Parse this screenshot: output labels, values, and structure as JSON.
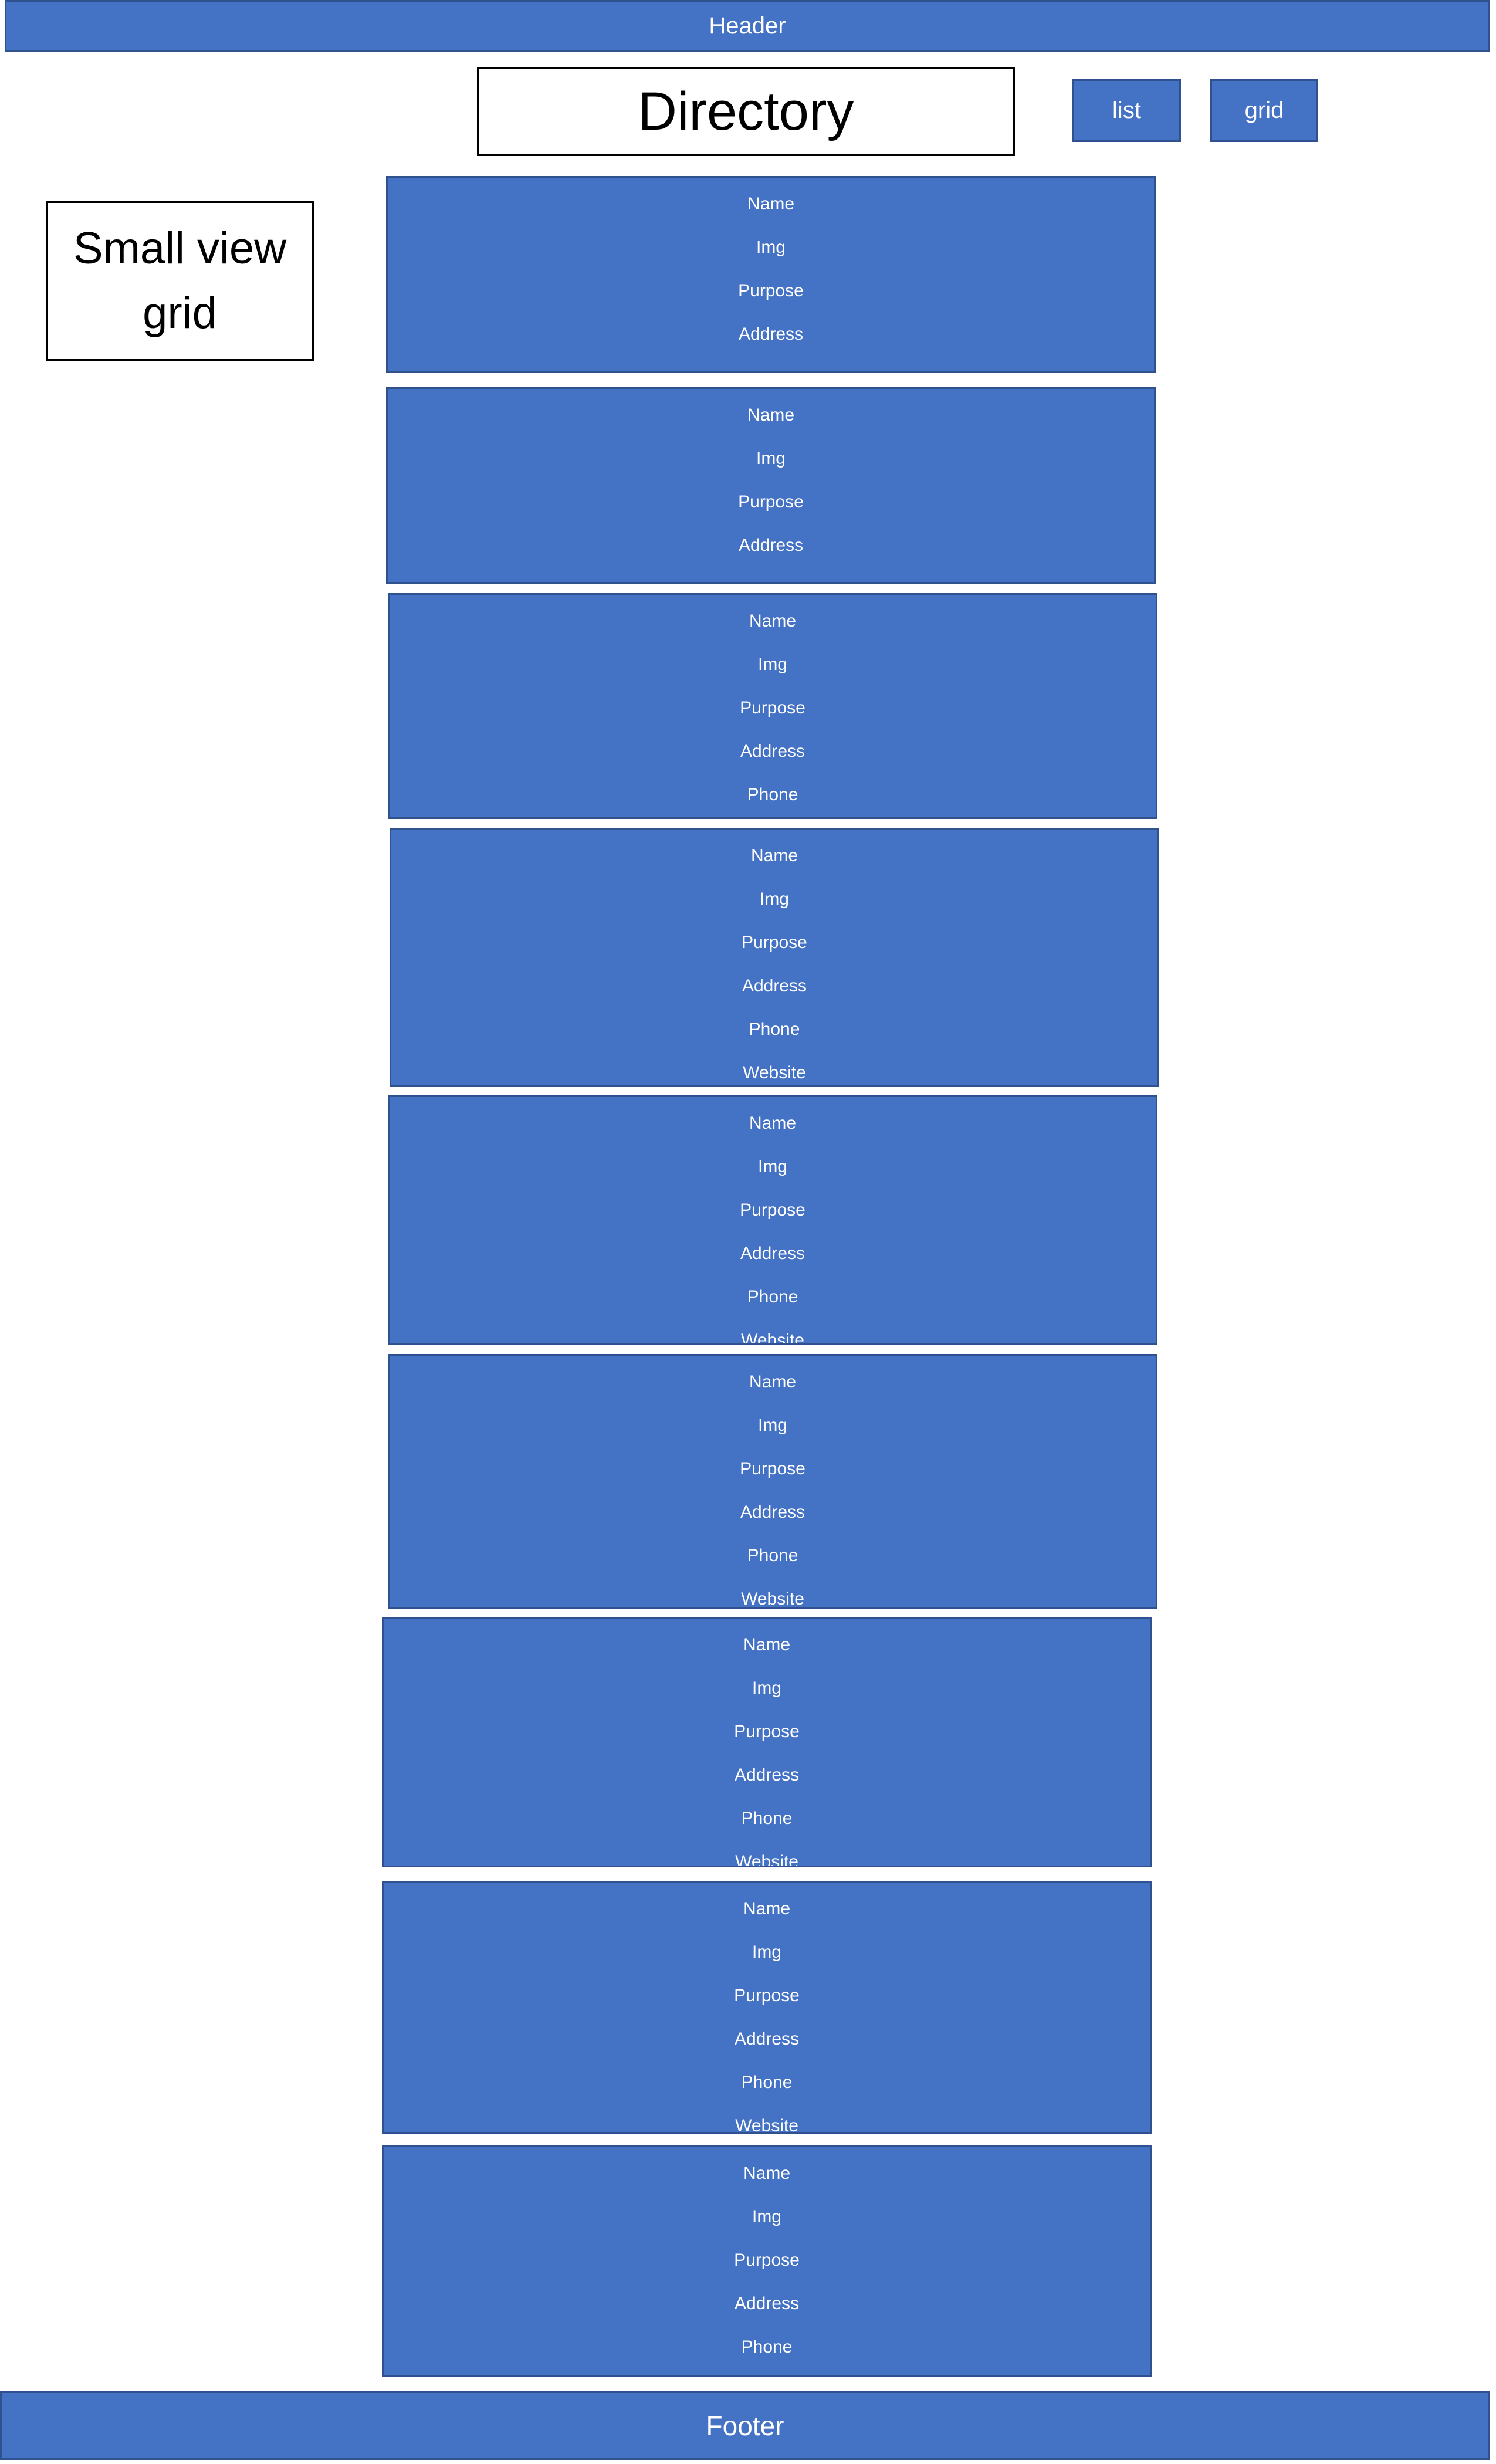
{
  "header": {
    "label": "Header"
  },
  "title": {
    "label": "Directory"
  },
  "note": {
    "label": "Small view grid"
  },
  "view_toggle": {
    "list_label": "list",
    "grid_label": "grid"
  },
  "cards": [
    {
      "fields": [
        "Name",
        "Img",
        "Purpose",
        "Address"
      ]
    },
    {
      "fields": [
        "Name",
        "Img",
        "Purpose",
        "Address"
      ]
    },
    {
      "fields": [
        "Name",
        "Img",
        "Purpose",
        "Address",
        "Phone"
      ]
    },
    {
      "fields": [
        "Name",
        "Img",
        "Purpose",
        "Address",
        "Phone",
        "Website"
      ]
    },
    {
      "fields": [
        "Name",
        "Img",
        "Purpose",
        "Address",
        "Phone",
        "Website"
      ]
    },
    {
      "fields": [
        "Name",
        "Img",
        "Purpose",
        "Address",
        "Phone",
        "Website"
      ]
    },
    {
      "fields": [
        "Name",
        "Img",
        "Purpose",
        "Address",
        "Phone",
        "Website"
      ]
    },
    {
      "fields": [
        "Name",
        "Img",
        "Purpose",
        "Address",
        "Phone",
        "Website"
      ]
    },
    {
      "fields": [
        "Name",
        "Img",
        "Purpose",
        "Address",
        "Phone"
      ]
    }
  ],
  "footer": {
    "label": "Footer"
  },
  "colors": {
    "box_fill": "#4472C4",
    "box_border": "#2F528F",
    "text_on_box": "#FFFFFF"
  }
}
